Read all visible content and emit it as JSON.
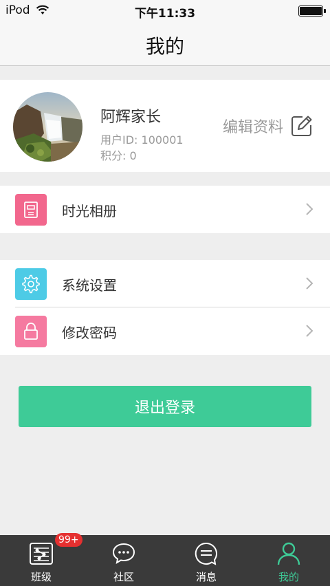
{
  "status_bar": {
    "carrier": "iPod",
    "time": "下午11:33"
  },
  "nav": {
    "title": "我的"
  },
  "profile": {
    "name": "阿辉家长",
    "user_id": "用户ID: 100001",
    "points": "积分: 0",
    "edit_label": "编辑资料"
  },
  "menu": {
    "album": {
      "label": "时光相册",
      "icon": "album-icon",
      "color": "#f2678d"
    },
    "settings": {
      "label": "系统设置",
      "icon": "gear-icon",
      "color": "#4dcbe6"
    },
    "password": {
      "label": "修改密码",
      "icon": "lock-icon",
      "color": "#f57aa0"
    }
  },
  "logout": {
    "label": "退出登录",
    "color": "#3ecb97"
  },
  "tabs": [
    {
      "label": "班级",
      "icon": "class-icon",
      "badge": "99+",
      "active": false
    },
    {
      "label": "社区",
      "icon": "community-chat-icon",
      "active": false
    },
    {
      "label": "消息",
      "icon": "message-icon",
      "active": false
    },
    {
      "label": "我的",
      "icon": "profile-person-icon",
      "active": true
    }
  ],
  "colors": {
    "accent": "#3ecb97",
    "badge": "#e53030",
    "tab_bar_bg": "#3a3a3a"
  }
}
